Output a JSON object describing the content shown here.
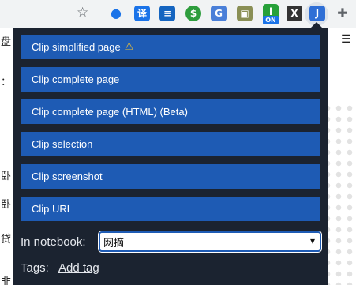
{
  "browser": {
    "extensions": [
      {
        "name": "chrome-dot-extension",
        "glyph": "●",
        "color": "#1a73e8"
      },
      {
        "name": "translate-extension",
        "glyph": "译",
        "color": "#1a73e8"
      },
      {
        "name": "dictionary-extension",
        "glyph": "≡",
        "color": "#1565c0"
      },
      {
        "name": "money-extension",
        "glyph": "$",
        "color": "#2e9d3d"
      },
      {
        "name": "google-translate-extension",
        "glyph": "G",
        "color": "#4a7fd8"
      },
      {
        "name": "image-extension",
        "glyph": "▣",
        "color": "#8a8f55"
      },
      {
        "name": "info-extension",
        "glyph": "i",
        "color": "#27a039"
      },
      {
        "name": "x-extension",
        "glyph": "X",
        "color": "#333333"
      },
      {
        "name": "clipper-extension",
        "glyph": "J",
        "color": "#2f6fd6"
      },
      {
        "name": "puzzle-extension",
        "glyph": "✚",
        "color": "#5f6368"
      }
    ],
    "on_badge": "ON"
  },
  "background": {
    "fragment_1": "盘",
    "fragment_2": "：",
    "fragment_3": "卧",
    "fragment_4": "卧",
    "fragment_5": "贷",
    "fragment_6": "非"
  },
  "popup": {
    "buttons": [
      {
        "label": "Clip simplified page",
        "warning": "⚠"
      },
      {
        "label": "Clip complete page"
      },
      {
        "label": "Clip complete page (HTML) (Beta)"
      },
      {
        "label": "Clip selection"
      },
      {
        "label": "Clip screenshot"
      },
      {
        "label": "Clip URL"
      }
    ],
    "notebook_label": "In notebook:",
    "notebook_value": "网摘",
    "tags_label": "Tags:",
    "add_tag_link": "Add tag"
  },
  "colors": {
    "popup_bg": "#1b2330",
    "button_bg": "#1e5bb4",
    "text": "#e6e9ee"
  }
}
